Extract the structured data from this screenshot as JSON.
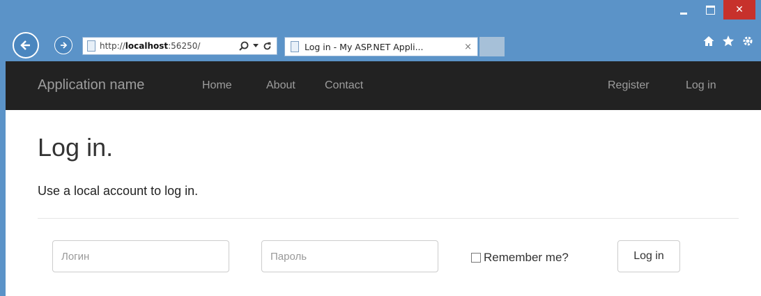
{
  "browser": {
    "url_prefix": "http://",
    "url_host": "localhost",
    "url_rest": ":56250/",
    "tab_title": "Log in - My ASP.NET Appli...",
    "tab_close": "×",
    "icons": [
      "back-icon",
      "forward-icon",
      "search-icon",
      "refresh-icon",
      "home-icon",
      "favorites-icon",
      "settings-icon"
    ]
  },
  "navbar": {
    "brand": "Application name",
    "links": [
      "Home",
      "About",
      "Contact"
    ],
    "right_links": [
      "Register",
      "Log in"
    ]
  },
  "main": {
    "title": "Log in.",
    "subtitle": "Use a local account to log in.",
    "login_placeholder": "Логин",
    "password_placeholder": "Пароль",
    "remember_label": "Remember me?",
    "submit_label": "Log in"
  },
  "colors": {
    "navbar_bg": "#222222",
    "nav_text": "#9d9d9d",
    "frame": "#5b93c8",
    "close_button": "#c7312b"
  }
}
